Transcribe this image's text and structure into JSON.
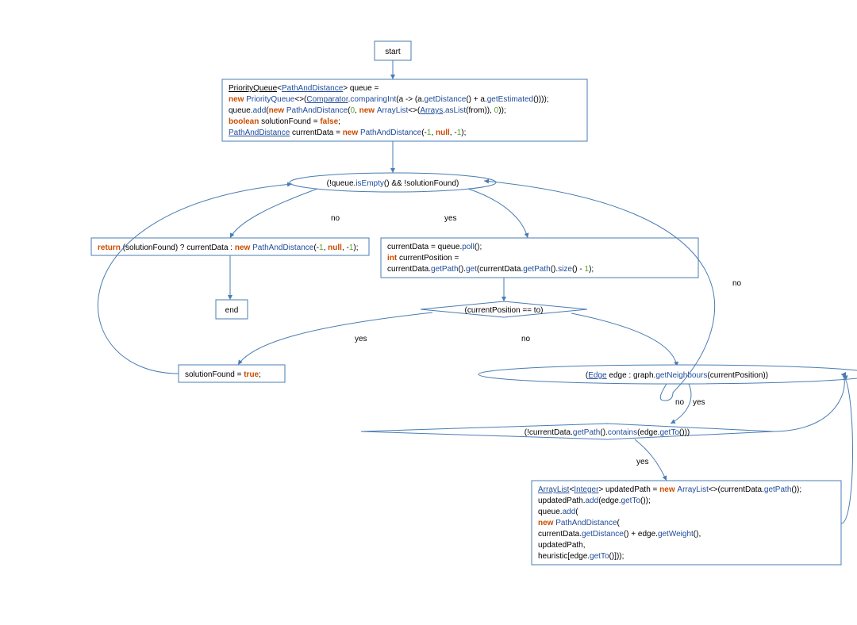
{
  "chart_data": {
    "type": "flowchart",
    "nodes": [
      {
        "id": "start",
        "kind": "terminal",
        "label": "start"
      },
      {
        "id": "init",
        "kind": "process",
        "code": "PriorityQueue<PathAndDistance> queue =\nnew PriorityQueue<>(Comparator.comparingInt(a -> (a.getDistance() + a.getEstimated())));\nqueue.add(new PathAndDistance(0, new ArrayList<>(Arrays.asList(from)), 0));\nboolean solutionFound = false;\nPathAndDistance currentData = new PathAndDistance(-1, null, -1);"
      },
      {
        "id": "loopCond",
        "kind": "decision",
        "code": "(!queue.isEmpty() && !solutionFound)"
      },
      {
        "id": "ret",
        "kind": "process",
        "code": "return (solutionFound) ? currentData : new PathAndDistance(-1, null, -1);"
      },
      {
        "id": "end",
        "kind": "terminal",
        "label": "end"
      },
      {
        "id": "poll",
        "kind": "process",
        "code": "currentData = queue.poll();\nint currentPosition =\ncurrentData.getPath().get(currentData.getPath().size() - 1);"
      },
      {
        "id": "atGoal",
        "kind": "decision",
        "code": "(currentPosition == to)"
      },
      {
        "id": "setFound",
        "kind": "process",
        "code": "solutionFound = true;"
      },
      {
        "id": "forEdges",
        "kind": "loop",
        "code": "(Edge edge : graph.getNeighbours(currentPosition))"
      },
      {
        "id": "notVisited",
        "kind": "decision",
        "code": "(!currentData.getPath().contains(edge.getTo()))"
      },
      {
        "id": "enqueue",
        "kind": "process",
        "code": "ArrayList<Integer> updatedPath = new ArrayList<>(currentData.getPath());\nupdatedPath.add(edge.getTo());\nqueue.add(\nnew PathAndDistance(\ncurrentData.getDistance() + edge.getWeight(),\nupdatedPath,\nheuristic[edge.getTo()]));"
      }
    ],
    "edges": [
      {
        "from": "start",
        "to": "init"
      },
      {
        "from": "init",
        "to": "loopCond"
      },
      {
        "from": "loopCond",
        "to": "ret",
        "label": "no"
      },
      {
        "from": "loopCond",
        "to": "poll",
        "label": "yes"
      },
      {
        "from": "ret",
        "to": "end"
      },
      {
        "from": "poll",
        "to": "atGoal"
      },
      {
        "from": "atGoal",
        "to": "setFound",
        "label": "yes"
      },
      {
        "from": "atGoal",
        "to": "forEdges",
        "label": "no"
      },
      {
        "from": "forEdges",
        "to": "notVisited",
        "label": "yes"
      },
      {
        "from": "forEdges",
        "to": "loopCond",
        "label": "no"
      },
      {
        "from": "notVisited",
        "to": "enqueue",
        "label": "yes"
      },
      {
        "from": "notVisited",
        "to": "forEdges",
        "label": "no"
      },
      {
        "from": "enqueue",
        "to": "forEdges"
      },
      {
        "from": "setFound",
        "to": "loopCond"
      }
    ]
  },
  "labels": {
    "start": "start",
    "end": "end",
    "yes": "yes",
    "no": "no"
  },
  "code": {
    "init": {
      "l1a": "PriorityQueue",
      "l1b": "<",
      "l1c": "PathAndDistance",
      "l1d": "> queue =",
      "l2a": "new ",
      "l2b": "PriorityQueue",
      "l2c": "<>(",
      "l2d": "Comparator",
      "l2e": ".",
      "l2f": "comparingInt",
      "l2g": "(a -> (a.",
      "l2h": "getDistance",
      "l2i": "() + a.",
      "l2j": "getEstimated",
      "l2k": "())));",
      "l3a": "queue.",
      "l3b": "add",
      "l3c": "(",
      "l3d": "new ",
      "l3e": "PathAndDistance",
      "l3f": "(",
      "l3g": "0",
      "l3h": ", ",
      "l3i": "new ",
      "l3j": "ArrayList",
      "l3k": "<>(",
      "l3l": "Arrays",
      "l3m": ".",
      "l3n": "asList",
      "l3o": "(from)), ",
      "l3p": "0",
      "l3q": "));",
      "l4a": "boolean ",
      "l4b": "solutionFound = ",
      "l4c": "false",
      "l4d": ";",
      "l5a": "PathAndDistance",
      "l5b": " currentData = ",
      "l5c": "new ",
      "l5d": "PathAndDistance",
      "l5e": "(-",
      "l5f": "1",
      "l5g": ", ",
      "l5h": "null",
      "l5i": ", -",
      "l5j": "1",
      "l5k": ");"
    },
    "loop": {
      "a": "(!queue.",
      "b": "isEmpty",
      "c": "() && !solutionFound)"
    },
    "ret": {
      "a": "return ",
      "b": "(solutionFound) ? currentData : ",
      "c": "new ",
      "d": "PathAndDistance",
      "e": "(-",
      "f": "1",
      "g": ", ",
      "h": "null",
      "i": ", -",
      "j": "1",
      "k": ");"
    },
    "poll": {
      "l1a": "currentData = queue.",
      "l1b": "poll",
      "l1c": "();",
      "l2a": "int ",
      "l2b": "currentPosition =",
      "l3a": "currentData.",
      "l3b": "getPath",
      "l3c": "().",
      "l3d": "get",
      "l3e": "(currentData.",
      "l3f": "getPath",
      "l3g": "().",
      "l3h": "size",
      "l3i": "() - ",
      "l3j": "1",
      "l3k": ");"
    },
    "atGoal": {
      "a": "(currentPosition == to)"
    },
    "setFound": {
      "a": "solutionFound = ",
      "b": "true",
      "c": ";"
    },
    "forEdges": {
      "a": "(",
      "b": "Edge",
      "c": " edge : graph.",
      "d": "getNeighbours",
      "e": "(currentPosition))"
    },
    "notVisited": {
      "a": "(!currentData.",
      "b": "getPath",
      "c": "().",
      "d": "contains",
      "e": "(edge.",
      "f": "getTo",
      "g": "()))"
    },
    "enqueue": {
      "l1a": "ArrayList",
      "l1b": "<",
      "l1c": "Integer",
      "l1d": "> updatedPath = ",
      "l1e": "new ",
      "l1f": "ArrayList",
      "l1g": "<>(currentData.",
      "l1h": "getPath",
      "l1i": "());",
      "l2a": "updatedPath.",
      "l2b": "add",
      "l2c": "(edge.",
      "l2d": "getTo",
      "l2e": "());",
      "l3a": "queue.",
      "l3b": "add",
      "l3c": "(",
      "l4a": "new ",
      "l4b": "PathAndDistance",
      "l4c": "(",
      "l5a": "currentData.",
      "l5b": "getDistance",
      "l5c": "() + edge.",
      "l5d": "getWeight",
      "l5e": "(),",
      "l6a": "updatedPath,",
      "l7a": "heuristic[edge.",
      "l7b": "getTo",
      "l7c": "()]));"
    }
  }
}
